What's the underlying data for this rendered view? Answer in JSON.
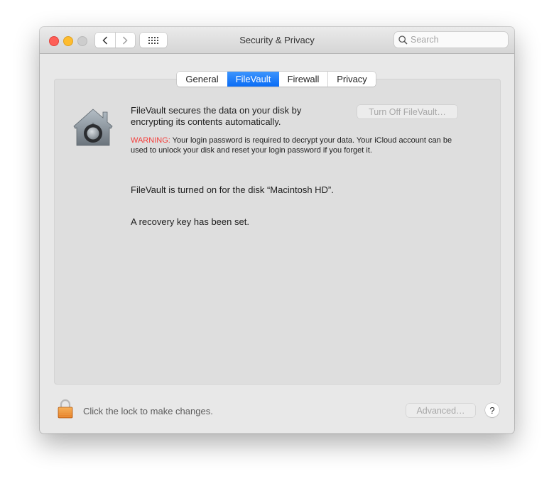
{
  "window": {
    "title": "Security & Privacy",
    "traffic_lights": [
      "close",
      "minimize",
      "zoom"
    ],
    "nav": {
      "back_icon": "chevron-left-icon",
      "forward_icon": "chevron-right-icon",
      "show_all_icon": "grid-icon"
    },
    "search": {
      "placeholder": "Search",
      "value": ""
    }
  },
  "tabs": [
    {
      "label": "General",
      "active": false
    },
    {
      "label": "FileVault",
      "active": true
    },
    {
      "label": "Firewall",
      "active": false
    },
    {
      "label": "Privacy",
      "active": false
    }
  ],
  "filevault": {
    "icon": "filevault-house-icon",
    "description": "FileVault secures the data on your disk by encrypting its contents automatically.",
    "turn_off_button": "Turn Off FileVault…",
    "warning_label": "WARNING:",
    "warning_text": " Your login password is required to decrypt your data. Your iCloud account can be used to unlock your disk and reset your login password if you forget it.",
    "status_disk": "FileVault is turned on for the disk “Macintosh HD”.",
    "status_recovery": "A recovery key has been set."
  },
  "footer": {
    "lock_icon": "lock-icon",
    "lock_text": "Click the lock to make changes.",
    "advanced_button": "Advanced…",
    "help_button": "?"
  },
  "colors": {
    "accent": "#0a6cf5",
    "warning": "#f33d3a",
    "close": "#fe5f57",
    "minimize": "#febc2e"
  }
}
